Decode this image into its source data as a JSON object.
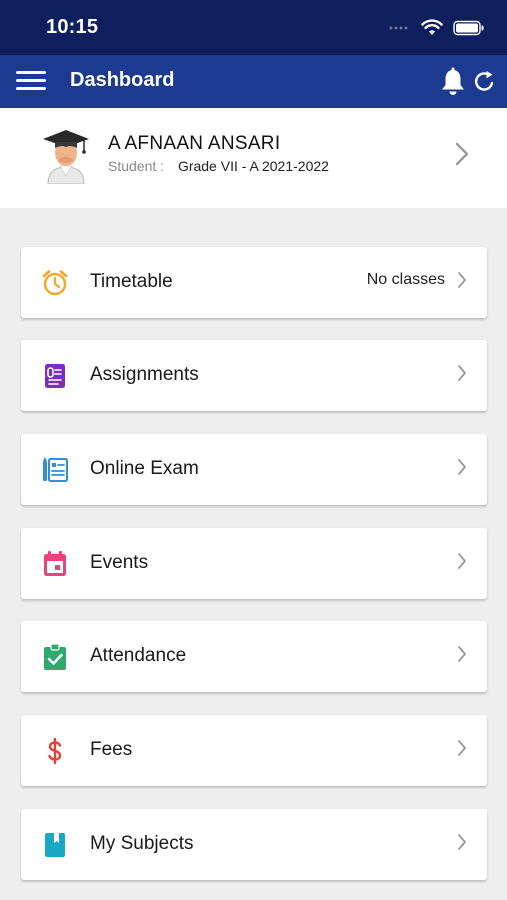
{
  "status_bar": {
    "time": "10:15"
  },
  "app_bar": {
    "title": "Dashboard"
  },
  "profile": {
    "name": "A AFNAAN ANSARI",
    "role_label": "Student :",
    "grade": "Grade VII - A 2021-2022"
  },
  "menu_items": [
    {
      "label": "Timetable",
      "value": "No classes",
      "icon": "alarm-clock-icon",
      "color": "#f5a623"
    },
    {
      "label": "Assignments",
      "value": "",
      "icon": "assignment-icon",
      "color": "#7b2fbe"
    },
    {
      "label": "Online Exam",
      "value": "",
      "icon": "online-exam-icon",
      "color": "#2f8fd8"
    },
    {
      "label": "Events",
      "value": "",
      "icon": "calendar-icon",
      "color": "#e8457a"
    },
    {
      "label": "Attendance",
      "value": "",
      "icon": "clipboard-check-icon",
      "color": "#2eaa6e"
    },
    {
      "label": "Fees",
      "value": "",
      "icon": "dollar-icon",
      "color": "#e5403a"
    },
    {
      "label": "My Subjects",
      "value": "",
      "icon": "book-icon",
      "color": "#18a8c4"
    }
  ],
  "colors": {
    "status_bar": "#0f1e5c",
    "app_bar": "#1c3a8f",
    "background": "#eeeeee"
  }
}
